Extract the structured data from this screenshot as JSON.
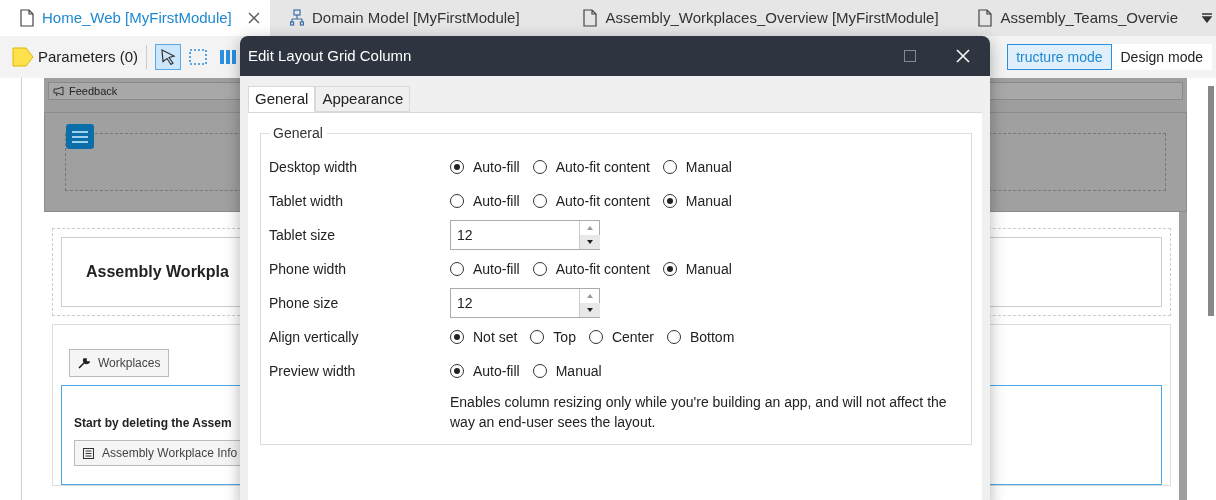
{
  "tabs": [
    {
      "label": "Home_Web [MyFirstModule]",
      "kind": "page",
      "selected": true
    },
    {
      "label": "Domain Model [MyFirstModule]",
      "kind": "model",
      "selected": false
    },
    {
      "label": "Assembly_Workplaces_Overview [MyFirstModule]",
      "kind": "page",
      "selected": false
    },
    {
      "label": "Assembly_Teams_Overvie",
      "kind": "page",
      "selected": false
    }
  ],
  "toolbar": {
    "parameters": "Parameters (0)",
    "tools": [
      {
        "kind": "pointer",
        "selected": true
      },
      {
        "kind": "select-box",
        "selected": false
      },
      {
        "kind": "columns",
        "selected": false
      }
    ],
    "modes": [
      {
        "label": "tructure mode",
        "selected": true
      },
      {
        "label": "Design mode",
        "selected": false
      }
    ]
  },
  "canvas": {
    "feedback": "Feedback",
    "heading": "Assembly Workpla",
    "button": "Workplaces",
    "instruction": "Start by deleting the Assem",
    "info_button": "Assembly Workplace Info"
  },
  "dialog": {
    "title": "Edit Layout Grid Column",
    "tabs": [
      {
        "label": "General",
        "selected": true
      },
      {
        "label": "Appearance",
        "selected": false
      }
    ],
    "group": "General",
    "rows": [
      {
        "kind": "radio",
        "label": "Desktop width",
        "options": [
          {
            "label": "Auto-fill",
            "selected": true
          },
          {
            "label": "Auto-fit content",
            "selected": false
          },
          {
            "label": "Manual",
            "selected": false
          }
        ]
      },
      {
        "kind": "radio",
        "label": "Tablet width",
        "options": [
          {
            "label": "Auto-fill",
            "selected": false
          },
          {
            "label": "Auto-fit content",
            "selected": false
          },
          {
            "label": "Manual",
            "selected": true
          }
        ]
      },
      {
        "kind": "number",
        "label": "Tablet size",
        "value": "12"
      },
      {
        "kind": "radio",
        "label": "Phone width",
        "options": [
          {
            "label": "Auto-fill",
            "selected": false
          },
          {
            "label": "Auto-fit content",
            "selected": false
          },
          {
            "label": "Manual",
            "selected": true
          }
        ]
      },
      {
        "kind": "number",
        "label": "Phone size",
        "value": "12"
      },
      {
        "kind": "radio",
        "label": "Align vertically",
        "options": [
          {
            "label": "Not set",
            "selected": true
          },
          {
            "label": "Top",
            "selected": false
          },
          {
            "label": "Center",
            "selected": false
          },
          {
            "label": "Bottom",
            "selected": false
          }
        ]
      },
      {
        "kind": "radio",
        "label": "Preview width",
        "options": [
          {
            "label": "Auto-fill",
            "selected": true
          },
          {
            "label": "Manual",
            "selected": false
          }
        ],
        "note": "Enables column resizing only while you're building an app, and will not affect the way an end-user sees the layout."
      }
    ]
  }
}
